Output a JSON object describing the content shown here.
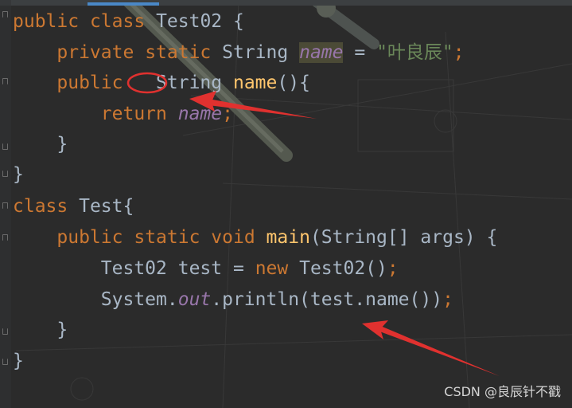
{
  "code": {
    "line1": {
      "kw1": "public",
      "kw2": "class",
      "name": "Test02",
      "brace": "{"
    },
    "line2": {
      "kw1": "private",
      "kw2": "static",
      "type": "String",
      "field": "name",
      "eq": "=",
      "value": "\"叶良辰\"",
      "semi": ";"
    },
    "line3": {
      "kw1": "public",
      "type": "String",
      "method": "name",
      "parens": "(){"
    },
    "line4": {
      "kw1": "return",
      "field": "name",
      "semi": ";"
    },
    "line5": {
      "text": "}"
    },
    "line6": {
      "text": "}"
    },
    "line7": {
      "kw1": "class",
      "name": "Test",
      "brace": "{"
    },
    "line8": {
      "kw1": "public",
      "kw2": "static",
      "kw3": "void",
      "method": "main",
      "params": "(String[] args) {"
    },
    "line9": {
      "type": "Test02",
      "var": "test",
      "eq": "=",
      "kw": "new",
      "ctor": "Test02()",
      "semi": ";"
    },
    "line10": {
      "obj": "System.",
      "field": "out",
      "call": ".println(test.name())",
      "semi": ";"
    },
    "line11": {
      "text": "}"
    },
    "line12": {
      "text": "}"
    }
  },
  "watermark": "CSDN @良辰针不戳",
  "colors": {
    "background": "#2b2b2b",
    "keyword": "#cc7832",
    "plain": "#a9b7c6",
    "field": "#9876aa",
    "string": "#6a8759",
    "method": "#ffc66d",
    "annotation": "#e0312f"
  }
}
